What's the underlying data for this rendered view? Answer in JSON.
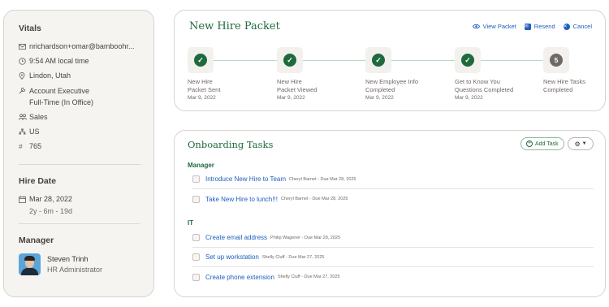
{
  "vitals": {
    "title": "Vitals",
    "email": "nrichardson+omar@bamboohr...",
    "local_time": "9:54 AM local time",
    "location": "Lindon, Utah",
    "job_title": "Account Executive",
    "employment": "Full-Time (In Office)",
    "department": "Sales",
    "country": "US",
    "employee_id": "765"
  },
  "hire": {
    "title": "Hire Date",
    "date": "Mar 28, 2022",
    "tenure": "2y - 6m - 19d"
  },
  "manager": {
    "title": "Manager",
    "name": "Steven Trinh",
    "role": "HR Administrator"
  },
  "packet": {
    "title": "New Hire Packet",
    "actions": {
      "view": "View Packet",
      "resend": "Resend",
      "cancel": "Cancel"
    },
    "steps": [
      {
        "label1": "New Hire",
        "label2": "Packet Sent",
        "date": "Mar 9, 2022",
        "status": "done"
      },
      {
        "label1": "New Hire",
        "label2": "Packet Viewed",
        "date": "Mar 9, 2022",
        "status": "done"
      },
      {
        "label1": "New Employee Info",
        "label2": "Completed",
        "date": "Mar 9, 2022",
        "status": "done"
      },
      {
        "label1": "Get to Know You",
        "label2": "Questions Completed",
        "date": "Mar 9, 2022",
        "status": "done"
      },
      {
        "label1": "New Hire Tasks",
        "label2": "Completed",
        "date": "",
        "status": "pending",
        "number": "5"
      }
    ]
  },
  "onboarding": {
    "title": "Onboarding Tasks",
    "add_task": "Add Task",
    "groups": [
      {
        "name": "Manager",
        "tasks": [
          {
            "title": "Introduce New Hire to Team",
            "meta": "Cheryl Barnet - Due Mar 28, 2025"
          },
          {
            "title": "Take New Hire to lunch!!!",
            "meta": "Cheryl Barnet - Due Mar 28, 2025"
          }
        ]
      },
      {
        "name": "IT",
        "tasks": [
          {
            "title": "Create email address",
            "meta": "Philip Wagener - Due Mar 28, 2025"
          },
          {
            "title": "Set up workstation",
            "meta": "Shelly Cluff - Due Mar 27, 2025"
          },
          {
            "title": "Create phone extension",
            "meta": "Shelly Cluff - Due Mar 27, 2025"
          }
        ]
      }
    ]
  },
  "colors": {
    "accent_green": "#1e6a3c",
    "link_blue": "#1f5fbf"
  }
}
